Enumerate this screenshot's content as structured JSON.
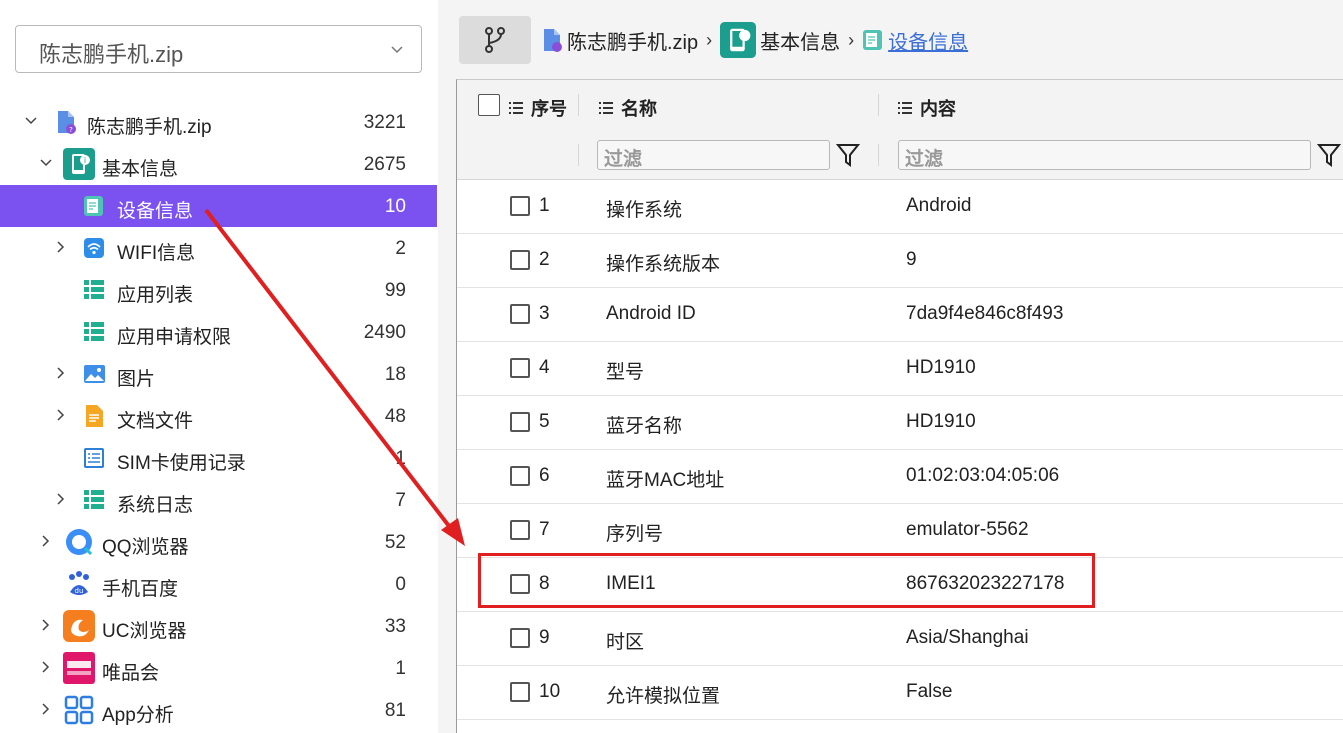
{
  "file_select": {
    "value": "陈志鹏手机.zip"
  },
  "tree": [
    {
      "label": "陈志鹏手机.zip",
      "count": "3221"
    },
    {
      "label": "基本信息",
      "count": "2675"
    },
    {
      "label": "设备信息",
      "count": "10"
    },
    {
      "label": "WIFI信息",
      "count": "2"
    },
    {
      "label": "应用列表",
      "count": "99"
    },
    {
      "label": "应用申请权限",
      "count": "2490"
    },
    {
      "label": "图片",
      "count": "18"
    },
    {
      "label": "文档文件",
      "count": "48"
    },
    {
      "label": "SIM卡使用记录",
      "count": "1"
    },
    {
      "label": "系统日志",
      "count": "7"
    },
    {
      "label": "QQ浏览器",
      "count": "52"
    },
    {
      "label": "手机百度",
      "count": "0"
    },
    {
      "label": "UC浏览器",
      "count": "33"
    },
    {
      "label": "唯品会",
      "count": "1"
    },
    {
      "label": "App分析",
      "count": "81"
    }
  ],
  "breadcrumb": {
    "root": "陈志鹏手机.zip",
    "category": "基本信息",
    "current": "设备信息"
  },
  "grid": {
    "headers": {
      "index": "序号",
      "name": "名称",
      "content": "内容"
    },
    "filter_placeholder": "过滤",
    "rows": [
      {
        "index": "1",
        "name": "操作系统",
        "content": "Android"
      },
      {
        "index": "2",
        "name": "操作系统版本",
        "content": "9"
      },
      {
        "index": "3",
        "name": "Android ID",
        "content": "7da9f4e846c8f493"
      },
      {
        "index": "4",
        "name": "型号",
        "content": "HD1910"
      },
      {
        "index": "5",
        "name": "蓝牙名称",
        "content": "HD1910"
      },
      {
        "index": "6",
        "name": "蓝牙MAC地址",
        "content": "01:02:03:04:05:06"
      },
      {
        "index": "7",
        "name": "序列号",
        "content": "emulator-5562"
      },
      {
        "index": "8",
        "name": "IMEI1",
        "content": "867632023227178"
      },
      {
        "index": "9",
        "name": "时区",
        "content": "Asia/Shanghai"
      },
      {
        "index": "10",
        "name": "允许模拟位置",
        "content": "False"
      }
    ]
  },
  "colors": {
    "selected": "#7b52f0",
    "highlight": "#e02020",
    "link": "#3b6fd6"
  },
  "icons": [
    "chevron-down-icon",
    "zip-file-icon",
    "basic-info-icon",
    "device-info-icon",
    "wifi-icon",
    "list-icon",
    "image-icon",
    "document-icon",
    "sim-icon",
    "qq-browser-icon",
    "baidu-icon",
    "uc-browser-icon",
    "vip-icon",
    "app-grid-icon",
    "branch-icon",
    "filter-icon",
    "column-menu-icon"
  ]
}
